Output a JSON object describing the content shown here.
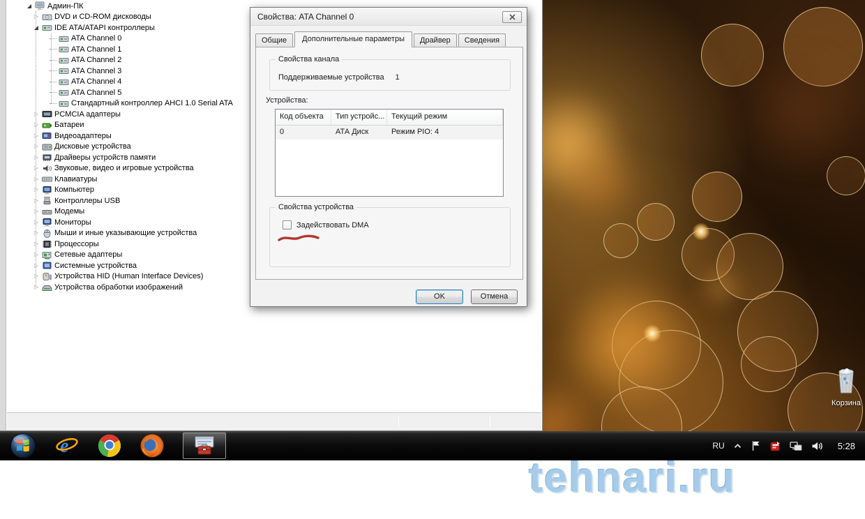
{
  "device_manager": {
    "tree": [
      {
        "label": "Админ-ПК",
        "level": 0,
        "expander": "open",
        "icon": "computer-icon"
      },
      {
        "label": "DVD и CD-ROM дисководы",
        "level": 1,
        "expander": "closed",
        "icon": "dvd-drive-icon"
      },
      {
        "label": "IDE ATA/ATAPI контроллеры",
        "level": 1,
        "expander": "open",
        "icon": "ide-controller-icon"
      },
      {
        "label": "ATA Channel 0",
        "level": 2,
        "expander": "none",
        "icon": "ata-channel-icon"
      },
      {
        "label": "ATA Channel 1",
        "level": 2,
        "expander": "none",
        "icon": "ata-channel-icon"
      },
      {
        "label": "ATA Channel 2",
        "level": 2,
        "expander": "none",
        "icon": "ata-channel-icon"
      },
      {
        "label": "ATA Channel 3",
        "level": 2,
        "expander": "none",
        "icon": "ata-channel-icon"
      },
      {
        "label": "ATA Channel 4",
        "level": 2,
        "expander": "none",
        "icon": "ata-channel-icon"
      },
      {
        "label": "ATA Channel 5",
        "level": 2,
        "expander": "none",
        "icon": "ata-channel-icon"
      },
      {
        "label": "Стандартный контроллер AHCI 1.0 Serial ATA",
        "level": 2,
        "expander": "none",
        "icon": "ata-channel-icon"
      },
      {
        "label": "PCMCIA адаптеры",
        "level": 1,
        "expander": "closed",
        "icon": "pcmcia-icon"
      },
      {
        "label": "Батареи",
        "level": 1,
        "expander": "closed",
        "icon": "battery-icon"
      },
      {
        "label": "Видеоадаптеры",
        "level": 1,
        "expander": "closed",
        "icon": "video-adapter-icon"
      },
      {
        "label": "Дисковые устройства",
        "level": 1,
        "expander": "closed",
        "icon": "disk-drive-icon"
      },
      {
        "label": "Драйверы устройств памяти",
        "level": 1,
        "expander": "closed",
        "icon": "memory-driver-icon"
      },
      {
        "label": "Звуковые, видео и игровые устройства",
        "level": 1,
        "expander": "closed",
        "icon": "sound-icon"
      },
      {
        "label": "Клавиатуры",
        "level": 1,
        "expander": "closed",
        "icon": "keyboard-icon"
      },
      {
        "label": "Компьютер",
        "level": 1,
        "expander": "closed",
        "icon": "computer-node-icon"
      },
      {
        "label": "Контроллеры USB",
        "level": 1,
        "expander": "closed",
        "icon": "usb-icon"
      },
      {
        "label": "Модемы",
        "level": 1,
        "expander": "closed",
        "icon": "modem-icon"
      },
      {
        "label": "Мониторы",
        "level": 1,
        "expander": "closed",
        "icon": "monitor-icon"
      },
      {
        "label": "Мыши и иные указывающие устройства",
        "level": 1,
        "expander": "closed",
        "icon": "mouse-icon"
      },
      {
        "label": "Процессоры",
        "level": 1,
        "expander": "closed",
        "icon": "cpu-icon"
      },
      {
        "label": "Сетевые адаптеры",
        "level": 1,
        "expander": "closed",
        "icon": "network-adapter-icon"
      },
      {
        "label": "Системные устройства",
        "level": 1,
        "expander": "closed",
        "icon": "system-device-icon"
      },
      {
        "label": "Устройства HID (Human Interface Devices)",
        "level": 1,
        "expander": "closed",
        "icon": "hid-icon"
      },
      {
        "label": "Устройства обработки изображений",
        "level": 1,
        "expander": "closed",
        "icon": "imaging-icon"
      }
    ]
  },
  "dialog": {
    "title": "Свойства: ATA Channel 0",
    "tabs": [
      {
        "label": "Общие",
        "active": false
      },
      {
        "label": "Дополнительные параметры",
        "active": true
      },
      {
        "label": "Драйвер",
        "active": false
      },
      {
        "label": "Сведения",
        "active": false
      }
    ],
    "channel_group": {
      "title": "Свойства канала",
      "supported_label": "Поддерживаемые устройства",
      "supported_value": "1"
    },
    "devices_label": "Устройства:",
    "devices_table": {
      "columns": [
        "Код объекта",
        "Тип устройс...",
        "Текущий режим"
      ],
      "rows": [
        [
          "0",
          "АТА Диск",
          "Режим PIO: 4"
        ]
      ]
    },
    "device_group": {
      "title": "Свойства устройства",
      "checkbox_label": "Задействовать DMA",
      "checkbox_checked": false
    },
    "ok_label": "OK",
    "cancel_label": "Отмена"
  },
  "taskbar": {
    "launchers": [
      {
        "name": "start-button",
        "icon": "windows-start-icon",
        "active": false
      },
      {
        "name": "internet-explorer-launcher",
        "icon": "internet-explorer-icon",
        "active": false
      },
      {
        "name": "chrome-launcher",
        "icon": "chrome-icon",
        "active": false
      },
      {
        "name": "firefox-launcher",
        "icon": "firefox-icon",
        "active": false
      },
      {
        "name": "device-manager-taskbar-button",
        "icon": "device-manager-icon",
        "active": true
      }
    ]
  },
  "tray": {
    "language": "RU",
    "time": "5:28",
    "icons": [
      {
        "name": "hidden-icons-button",
        "icon": "chevron-up-icon"
      },
      {
        "name": "action-center-tray-icon",
        "icon": "flag-icon"
      },
      {
        "name": "red-app-tray-icon",
        "icon": "red-app-icon"
      },
      {
        "name": "network-tray-icon",
        "icon": "network-icon"
      },
      {
        "name": "volume-tray-icon",
        "icon": "speaker-icon"
      }
    ]
  },
  "desktop": {
    "recycle_bin_label": "Корзина"
  },
  "watermark": {
    "text": "tehnari.ru"
  },
  "colors": {
    "annotation_underline": "#b23830",
    "watermark_blue": "#a3c9e8",
    "taskbar_black": "#060606",
    "ok_focus_border": "#3c7fb1",
    "selected_row": "#f3f3f3"
  }
}
